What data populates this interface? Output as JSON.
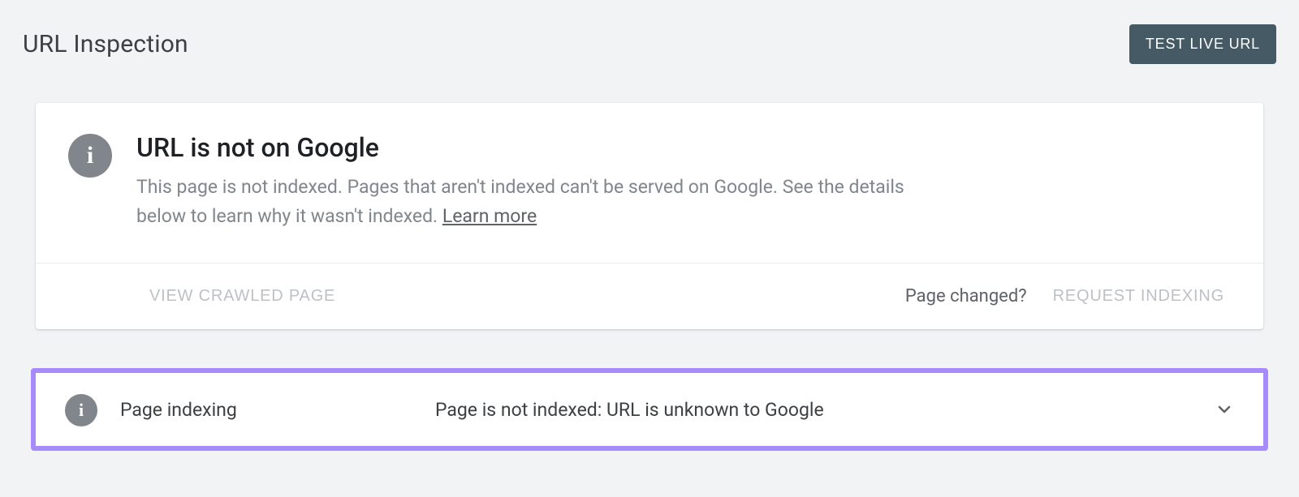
{
  "header": {
    "title": "URL Inspection",
    "test_button_label": "TEST LIVE URL"
  },
  "status_card": {
    "title": "URL is not on Google",
    "description": "This page is not indexed. Pages that aren't indexed can't be served on Google. See the details below to learn why it wasn't indexed. ",
    "learn_more_label": "Learn more",
    "actions": {
      "view_crawled_label": "VIEW CRAWLED PAGE",
      "page_changed_label": "Page changed?",
      "request_indexing_label": "REQUEST INDEXING"
    }
  },
  "page_indexing_row": {
    "label": "Page indexing",
    "value": "Page is not indexed: URL is unknown to Google"
  }
}
